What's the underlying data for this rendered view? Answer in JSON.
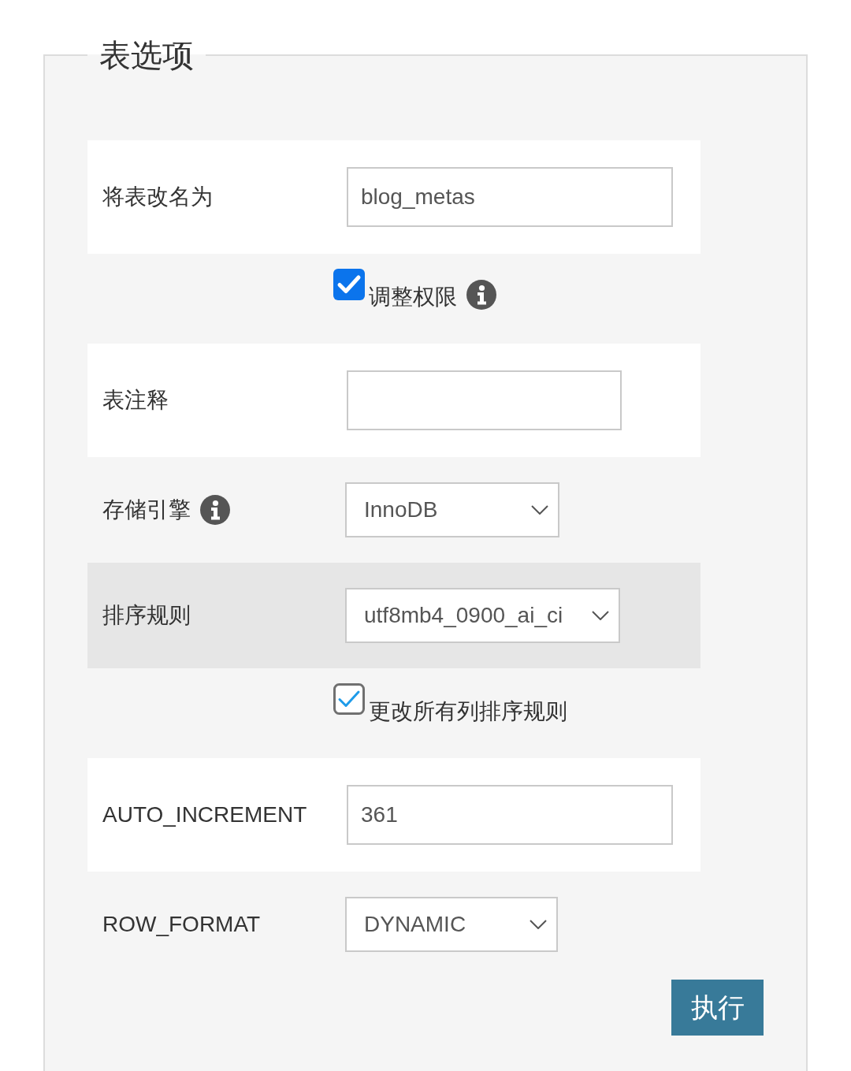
{
  "panel": {
    "legend": "表选项"
  },
  "rows": [
    {
      "kind": "text",
      "label": "将表改名为",
      "value": "blog_metas",
      "info": false,
      "highlighted": false
    },
    {
      "kind": "checkbox",
      "label": "调整权限",
      "checked": true,
      "focused": true,
      "info": true,
      "highlighted": false
    },
    {
      "kind": "text",
      "label": "表注释",
      "info": false,
      "highlighted": false
    },
    {
      "kind": "select",
      "label": "存储引擎",
      "value": "InnoDB",
      "info": true,
      "highlighted": false
    },
    {
      "kind": "select",
      "label": "排序规则",
      "value": "utf8mb4_0900_ai_ci",
      "info": false,
      "highlighted": true
    },
    {
      "kind": "checkbox",
      "label": "更改所有列排序规则",
      "checked": true,
      "focused": false,
      "info": false,
      "highlighted": false
    },
    {
      "kind": "text",
      "label": "AUTO_INCREMENT",
      "value": "361",
      "info": false,
      "highlighted": false
    },
    {
      "kind": "select",
      "label": "ROW_FORMAT",
      "value": "DYNAMIC",
      "info": false,
      "highlighted": false
    }
  ],
  "submit": {
    "label": "执行"
  }
}
